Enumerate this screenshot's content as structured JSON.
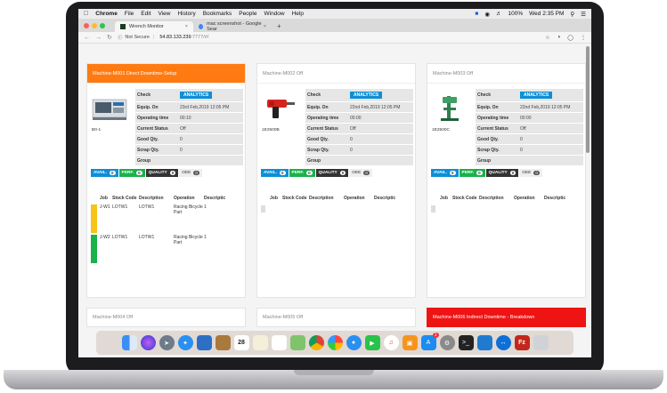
{
  "menubar": {
    "app": "Chrome",
    "items": [
      "File",
      "Edit",
      "View",
      "History",
      "Bookmarks",
      "People",
      "Window",
      "Help"
    ],
    "battery": "100%",
    "clock": "Wed 2:35 PM"
  },
  "tabs": [
    {
      "title": "Wrench Monitor",
      "favicon": "wrench-icon"
    },
    {
      "title": "mac screenshot - Google Sear",
      "favicon": "google-icon"
    }
  ],
  "address": {
    "security": "Not Secure",
    "host": "54.83.133.239",
    "path": ":7777/#/"
  },
  "cards": [
    {
      "header": "Machine-M001 Direct Downtime-Setup",
      "header_color": "#ff7b12",
      "machine_label": "B0-1",
      "check_label": "Check",
      "analytics_label": "ANALYTICS",
      "info": [
        {
          "k": "Equip. On",
          "v": "23rd Feb,2019 12:05 PM"
        },
        {
          "k": "Operating time",
          "v": "00:10"
        },
        {
          "k": "Current Status",
          "v": "Off"
        },
        {
          "k": "Good Qty.",
          "v": "0"
        },
        {
          "k": "Scrap Qty.",
          "v": "0"
        },
        {
          "k": "Group",
          "v": ""
        }
      ],
      "badges": {
        "avail": "AVAIL.",
        "avail_v": "0",
        "perf": "PERF.",
        "perf_v": "0",
        "quality": "QUALITY",
        "quality_v": "0",
        "oee": "OEE",
        "oee_v": "0"
      },
      "job_headers": [
        "Job",
        "Stock Code",
        "Description",
        "Operation",
        "Descriptic"
      ],
      "jobs": [
        {
          "job": "J-W1",
          "stock": "LOTW1",
          "desc": "LOTW1",
          "op": "Racing Bicycle Part",
          "d2": "1",
          "color": "#f5c518"
        },
        {
          "job": "J-W2",
          "stock": "LOTW1",
          "desc": "LOTW1",
          "op": "Racing Bicycle Part",
          "d2": "1",
          "color": "#1ab24a"
        }
      ]
    },
    {
      "header": "Machine-M002 Off",
      "header_color": "#ffffff",
      "machine_label": "1E2500B",
      "check_label": "Check",
      "analytics_label": "ANALYTICS",
      "info": [
        {
          "k": "Equip. On",
          "v": "22nd Feb,2019 12:05 PM"
        },
        {
          "k": "Operating time",
          "v": "00:00"
        },
        {
          "k": "Current Status",
          "v": "Off"
        },
        {
          "k": "Good Qty.",
          "v": "0"
        },
        {
          "k": "Scrap Qty.",
          "v": "0"
        },
        {
          "k": "Group",
          "v": ""
        }
      ],
      "badges": {
        "avail": "AVAIL.",
        "avail_v": "0",
        "perf": "PERF.",
        "perf_v": "0",
        "quality": "QUALITY",
        "quality_v": "0",
        "oee": "OEE",
        "oee_v": "0"
      },
      "job_headers": [
        "Job",
        "Stock Code",
        "Description",
        "Operation",
        "Descriptic"
      ],
      "jobs": []
    },
    {
      "header": "Machine-M003 Off",
      "header_color": "#ffffff",
      "machine_label": "1E2500C",
      "check_label": "Check",
      "analytics_label": "ANALYTICS",
      "info": [
        {
          "k": "Equip. On",
          "v": "22nd Feb,2019 12:05 PM"
        },
        {
          "k": "Operating time",
          "v": "00:00"
        },
        {
          "k": "Current Status",
          "v": "Off"
        },
        {
          "k": "Good Qty.",
          "v": "0"
        },
        {
          "k": "Scrap Qty.",
          "v": "0"
        },
        {
          "k": "Group",
          "v": ""
        }
      ],
      "badges": {
        "avail": "AVAIL.",
        "avail_v": "0",
        "perf": "PERF.",
        "perf_v": "0",
        "quality": "QUALITY",
        "quality_v": "0",
        "oee": "OEE",
        "oee_v": "0"
      },
      "job_headers": [
        "Job",
        "Stock Code",
        "Description",
        "Operation",
        "Descriptic"
      ],
      "jobs": []
    }
  ],
  "bottom_cards": [
    {
      "label": "Machine-M004 Off"
    },
    {
      "label": "Machine-M005 Off"
    },
    {
      "label": "Machine-M006 Indirect Downtime - Breakdown"
    }
  ],
  "dock": [
    "finder-icon",
    "siri-icon",
    "launchpad-icon",
    "safari-icon",
    "photos-icon",
    "notes-icon",
    "calendar-icon",
    "stickies-icon",
    "reminders-icon",
    "maps-icon",
    "chrome-icon",
    "photos2-icon",
    "messages-icon",
    "facetime-icon",
    "music-icon",
    "books-icon",
    "appstore-icon",
    "preferences-icon",
    "terminal-icon",
    "vscode-icon",
    "teamviewer-icon",
    "filezilla-icon",
    "trash-icon"
  ],
  "calendar_day": "28",
  "appstore_badge": "1"
}
